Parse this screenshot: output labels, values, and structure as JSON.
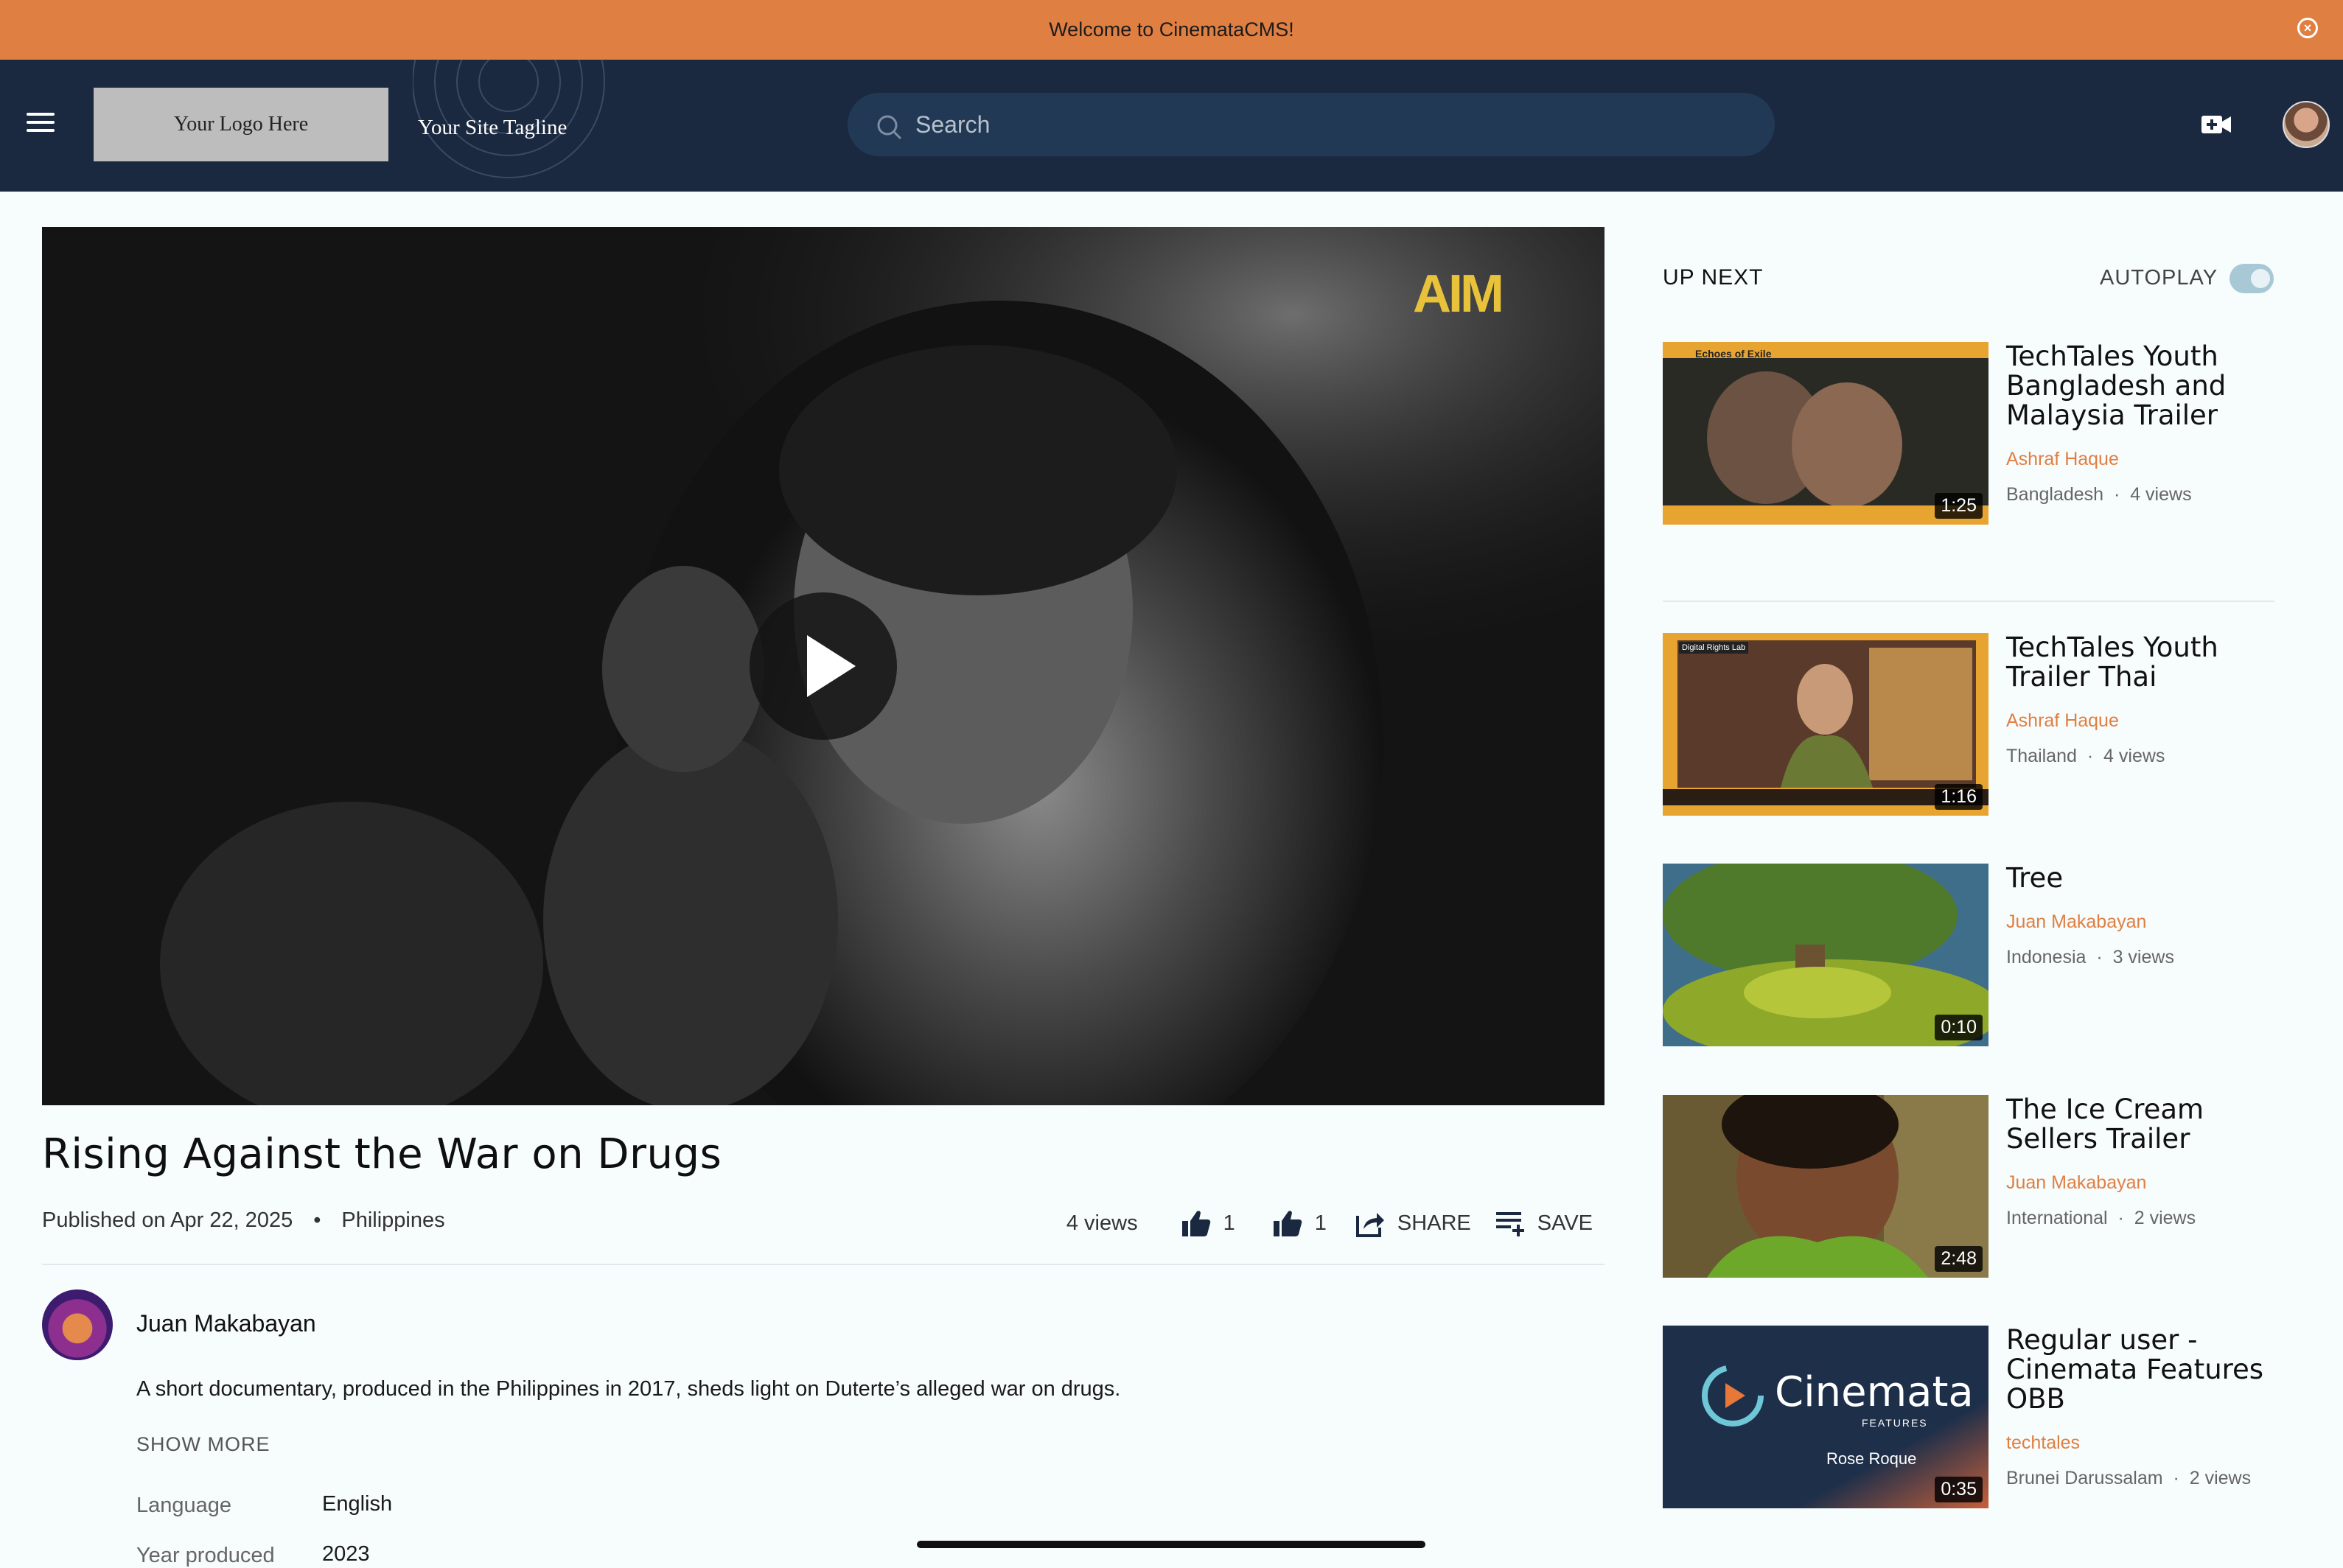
{
  "banner": {
    "text": "Welcome to CinemataCMS!",
    "close_icon": "close-circle-icon"
  },
  "header": {
    "logo_text": "Your Logo Here",
    "tagline": "Your Site Tagline",
    "search_placeholder": "Search",
    "menu_icon": "hamburger-icon",
    "upload_icon": "video-plus-icon"
  },
  "video": {
    "watermark": "AIM",
    "title": "Rising Against the War on Drugs",
    "published": "Published on Apr 22, 2025",
    "separator": "•",
    "country": "Philippines",
    "views": "4 views",
    "likes": "1",
    "dislikes": "1",
    "share_label": "SHARE",
    "save_label": "SAVE"
  },
  "author": {
    "name": "Juan Makabayan",
    "description": "A short documentary, produced in the Philippines in 2017, sheds light on Duterte’s alleged war on drugs.",
    "show_more": "SHOW MORE",
    "info": [
      {
        "label": "Language",
        "value": "English"
      },
      {
        "label": "Year produced",
        "value": "2023"
      }
    ]
  },
  "sidebar": {
    "up_next": "UP NEXT",
    "autoplay": "AUTOPLAY",
    "autoplay_on": true,
    "items": [
      {
        "title": "TechTales Youth Bangladesh and Malaysia Trailer",
        "author": "Ashraf Haque",
        "country": "Bangladesh",
        "views": "4 views",
        "duration": "1:25",
        "thumb_caption": "Echoes of Exile"
      },
      {
        "title": "TechTales Youth Trailer Thai",
        "author": "Ashraf Haque",
        "country": "Thailand",
        "views": "4 views",
        "duration": "1:16",
        "thumb_caption": "Digital Rights Lab"
      },
      {
        "title": "Tree",
        "author": "Juan Makabayan",
        "country": "Indonesia",
        "views": "3 views",
        "duration": "0:10"
      },
      {
        "title": "The Ice Cream Sellers Trailer",
        "author": "Juan Makabayan",
        "country": "International",
        "views": "2 views",
        "duration": "2:48"
      },
      {
        "title": "Regular user - Cinemata Features OBB",
        "author": "techtales",
        "country": "Brunei Darussalam",
        "views": "2 views",
        "duration": "0:35",
        "thumb_brand": "Cinemata",
        "thumb_sub": "FEATURES",
        "thumb_name": "Rose Roque"
      }
    ],
    "dot": "·"
  }
}
